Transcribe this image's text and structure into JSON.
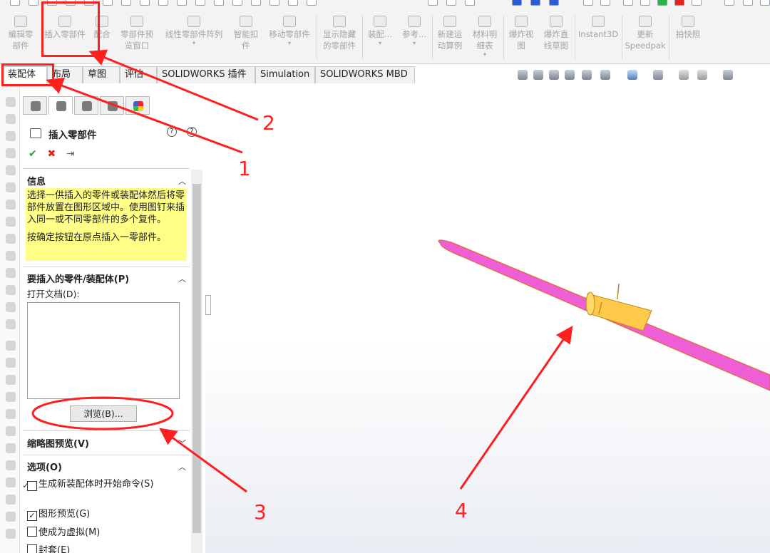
{
  "ribbon": {
    "buttons": [
      {
        "label": "编辑零\n部件",
        "icon": "edit-component-icon"
      },
      {
        "label": "插入零部件",
        "icon": "insert-component-icon"
      },
      {
        "label": "配合",
        "icon": "mate-icon"
      },
      {
        "label": "零部件预\n览窗口",
        "icon": "preview-window-icon"
      },
      {
        "label": "线性零部件阵列",
        "icon": "linear-pattern-icon"
      },
      {
        "label": "智能扣\n件",
        "icon": "smart-fastener-icon"
      },
      {
        "label": "移动零部件",
        "icon": "move-component-icon"
      },
      {
        "label": "显示隐藏\n的零部件",
        "icon": "show-hidden-icon"
      },
      {
        "label": "装配...",
        "icon": "assembly-features-icon"
      },
      {
        "label": "参考...",
        "icon": "reference-geometry-icon"
      },
      {
        "label": "新建运\n动算例",
        "icon": "motion-study-icon"
      },
      {
        "label": "材料明\n细表",
        "icon": "bom-icon"
      },
      {
        "label": "爆炸视\n图",
        "icon": "exploded-view-icon"
      },
      {
        "label": "爆炸直\n线草图",
        "icon": "explode-line-sketch-icon"
      },
      {
        "label": "Instant3D",
        "icon": "instant3d-icon"
      },
      {
        "label": "更新\nSpeedpak",
        "icon": "speedpak-icon"
      },
      {
        "label": "拍快照",
        "icon": "snapshot-icon"
      }
    ]
  },
  "tabs": [
    "装配体",
    "布局",
    "草图",
    "评估",
    "SOLIDWORKS 插件",
    "Simulation",
    "SOLIDWORKS MBD"
  ],
  "panel": {
    "title": "插入零部件",
    "help": "?",
    "info_heading": "信息",
    "info_text_1": "选择一供插入的零件或装配体然后将零部件放置在图形区域中。使用图钉来插入同一或不同零部件的多个复件。",
    "info_text_2": "按确定按钮在原点插入一零部件。",
    "part_heading": "要插入的零件/装配体(P)",
    "open_docs_label": "打开文档(D):",
    "browse_label": "浏览(B)...",
    "thumb_heading": "缩略图预览(V)",
    "options_heading": "选项(O)",
    "options": [
      {
        "label": "生成新装配体时开始命令(S)",
        "checked": true
      },
      {
        "label": "图形预览(G)",
        "checked": true
      },
      {
        "label": "使成为虚拟(M)",
        "checked": false
      },
      {
        "label": "封套(E)",
        "checked": false
      }
    ]
  },
  "annotations": [
    "1",
    "2",
    "3",
    "4"
  ],
  "colors": {
    "annotation": "#ff1f1f",
    "model_body": "#ee5fd6",
    "model_insert": "#ffc94a",
    "info_bg": "#ffff88"
  }
}
